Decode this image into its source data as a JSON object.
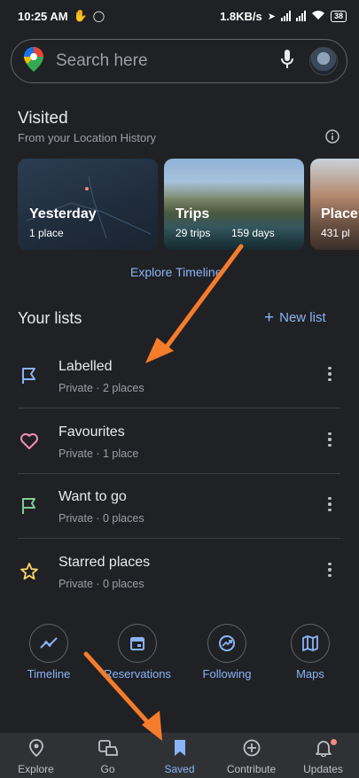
{
  "status_bar": {
    "time": "10:25 AM",
    "speed": "1.8KB/s",
    "battery": "38"
  },
  "search": {
    "placeholder": "Search here"
  },
  "visited": {
    "title": "Visited",
    "subtitle": "From your Location History",
    "cards": [
      {
        "title": "Yesterday",
        "subtitle": "1 place"
      },
      {
        "title": "Trips",
        "subtitle": "29 trips",
        "subtitle2": "159 days"
      },
      {
        "title": "Place",
        "subtitle": "431 pl"
      }
    ],
    "explore_link": "Explore Timeline"
  },
  "lists": {
    "title": "Your lists",
    "new_list": "New list",
    "items": [
      {
        "name": "Labelled",
        "meta": "Private · 2 places",
        "icon": "label-flag-icon",
        "color": "#8ab4f8"
      },
      {
        "name": "Favourites",
        "meta": "Private · 1 place",
        "icon": "heart-icon",
        "color": "#f48fb1"
      },
      {
        "name": "Want to go",
        "meta": "Private · 0 places",
        "icon": "flag-icon",
        "color": "#81c995"
      },
      {
        "name": "Starred places",
        "meta": "Private · 0 places",
        "icon": "star-icon",
        "color": "#fdd663"
      }
    ]
  },
  "shortcuts": [
    {
      "label": "Timeline",
      "icon": "timeline-icon"
    },
    {
      "label": "Reservations",
      "icon": "calendar-icon"
    },
    {
      "label": "Following",
      "icon": "following-icon"
    },
    {
      "label": "Maps",
      "icon": "map-icon"
    }
  ],
  "nav": [
    {
      "label": "Explore",
      "icon": "location-pin-icon"
    },
    {
      "label": "Go",
      "icon": "commute-icon"
    },
    {
      "label": "Saved",
      "icon": "bookmark-icon",
      "active": true
    },
    {
      "label": "Contribute",
      "icon": "add-circle-icon"
    },
    {
      "label": "Updates",
      "icon": "bell-icon"
    }
  ],
  "colors": {
    "background": "#202124",
    "accent": "#8ab4f8",
    "arrow": "#f57c2b"
  }
}
